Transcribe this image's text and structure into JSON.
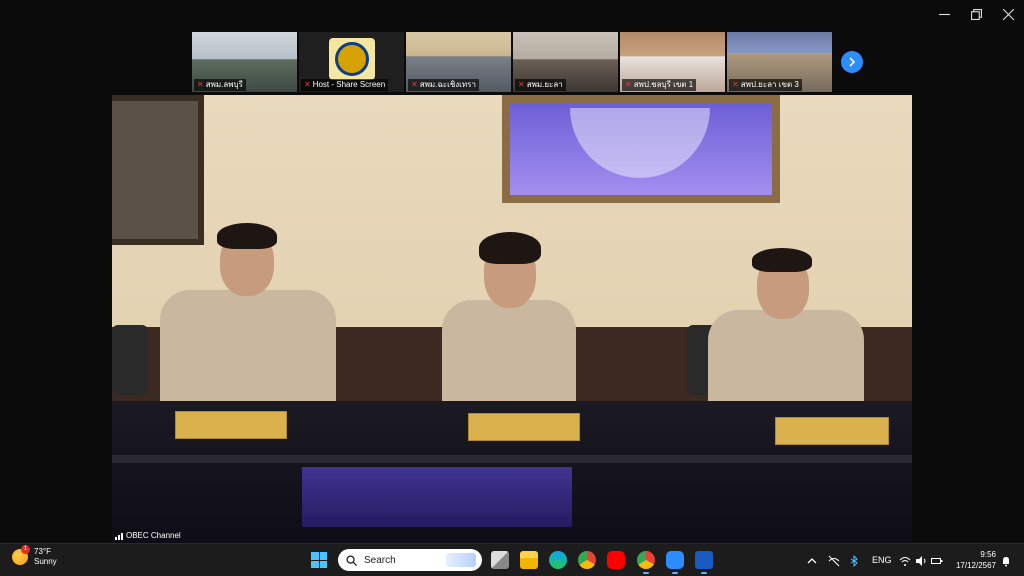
{
  "window": {
    "minimize_icon": "minimize-icon",
    "restore_icon": "restore-icon",
    "close_icon": "close-icon"
  },
  "participants": [
    {
      "name": "สพม.ลพบุรี",
      "muted": true
    },
    {
      "name": "Host - Share Screen",
      "muted": true
    },
    {
      "name": "สพม.ฉะเชิงเทรา",
      "muted": true
    },
    {
      "name": "สพม.ยะลา",
      "muted": true
    },
    {
      "name": "สพป.ชลบุรี เขต 1",
      "muted": true
    },
    {
      "name": "สพป.ยะลา เขต 3",
      "muted": true
    }
  ],
  "main_video": {
    "channel_label": "OBEC Channel"
  },
  "taskbar": {
    "weather": {
      "temp": "73°F",
      "condition": "Sunny",
      "badge": "1"
    },
    "search_placeholder": "Search",
    "apps": [
      "task-view",
      "file-explorer",
      "edge",
      "chrome",
      "youtube",
      "chrome-profile",
      "zoom",
      "word"
    ],
    "tray": {
      "language": "ENG"
    },
    "clock": {
      "time": "9:56",
      "date": "17/12/2567"
    }
  },
  "colors": {
    "accent": "#2d8cff",
    "muted_mic": "#e53935",
    "taskbar": "#1c1c1c"
  }
}
